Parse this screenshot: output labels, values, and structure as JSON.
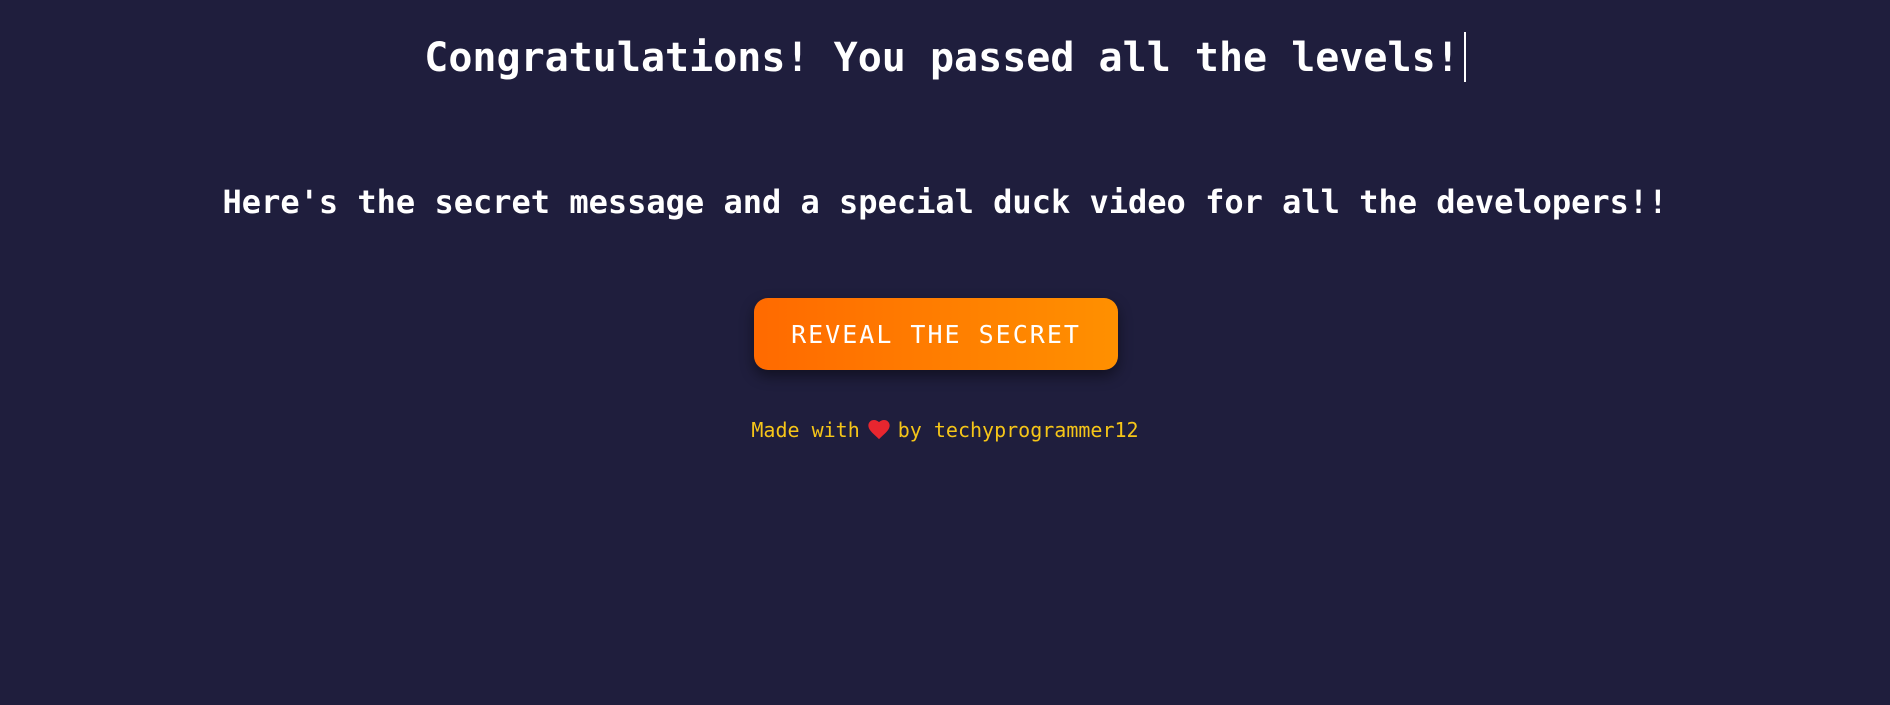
{
  "headline": {
    "text": "Congratulations! You passed all the levels!"
  },
  "subline": {
    "text": "Here's the secret message and a special duck video for all the developers!!"
  },
  "reveal_button": {
    "label": "REVEAL THE SECRET"
  },
  "footer": {
    "prefix": "Made with",
    "icon": "heart-icon",
    "suffix": "by techyprogrammer12"
  },
  "colors": {
    "background": "#1f1e3d",
    "text": "#ffffff",
    "button_gradient_start": "#ff6a00",
    "button_gradient_end": "#ff9000",
    "footer_text": "#f5c518",
    "heart": "#e8262f"
  }
}
